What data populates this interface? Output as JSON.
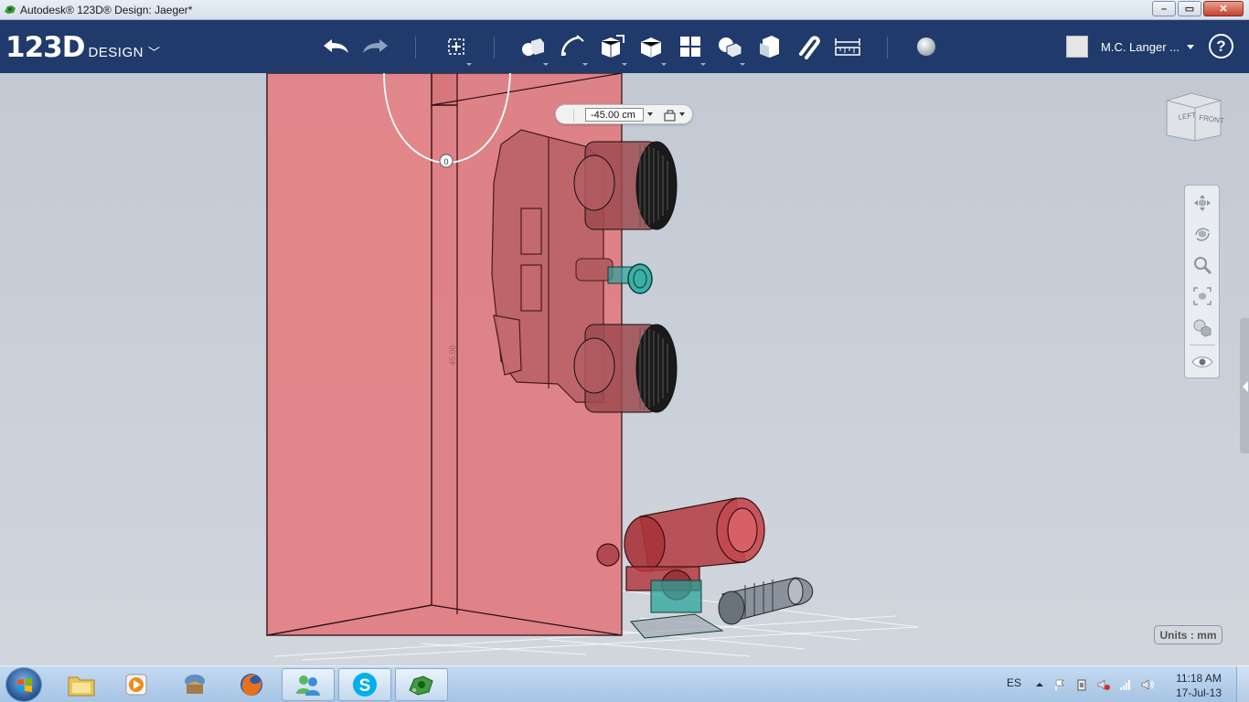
{
  "window": {
    "title": "Autodesk® 123D® Design: Jaeger*",
    "buttons": [
      "minimize",
      "maximize",
      "close"
    ]
  },
  "toolbar": {
    "logo_number": "123D",
    "logo_word": "DESIGN",
    "tools": [
      {
        "name": "undo-icon"
      },
      {
        "name": "redo-icon"
      },
      {
        "name": "transform-icon"
      },
      {
        "name": "primitives-icon"
      },
      {
        "name": "sketch-icon"
      },
      {
        "name": "construct-icon"
      },
      {
        "name": "modify-icon"
      },
      {
        "name": "pattern-icon"
      },
      {
        "name": "grouping-icon"
      },
      {
        "name": "combine-icon"
      },
      {
        "name": "snap-icon"
      },
      {
        "name": "measure-icon"
      },
      {
        "name": "material-icon"
      }
    ],
    "user_name": "M.C. Langer ...",
    "help_label": "?"
  },
  "viewport": {
    "dimension_value": "-45.00 cm",
    "viewcube_faces": [
      "LEFT",
      "FRONT"
    ],
    "nav_tools": [
      "pan-icon",
      "orbit-icon",
      "zoom-icon",
      "fit-icon",
      "view-mode-icon",
      "visibility-icon"
    ],
    "units_label": "Units : mm",
    "rotation_handle_value": "0",
    "dimension_text_on_box": "45.00"
  },
  "colors": {
    "toolbar_bg": "#1f3a6b",
    "box_fill": "#e07a7e",
    "selection_teal": "#2aa39a"
  },
  "taskbar": {
    "apps": [
      "windows-explorer-icon",
      "media-player-icon",
      "game-icon",
      "firefox-icon",
      "messenger-icon",
      "skype-icon",
      "123d-design-icon"
    ],
    "language": "ES",
    "time": "11:18 AM",
    "date": "17-Jul-13"
  }
}
